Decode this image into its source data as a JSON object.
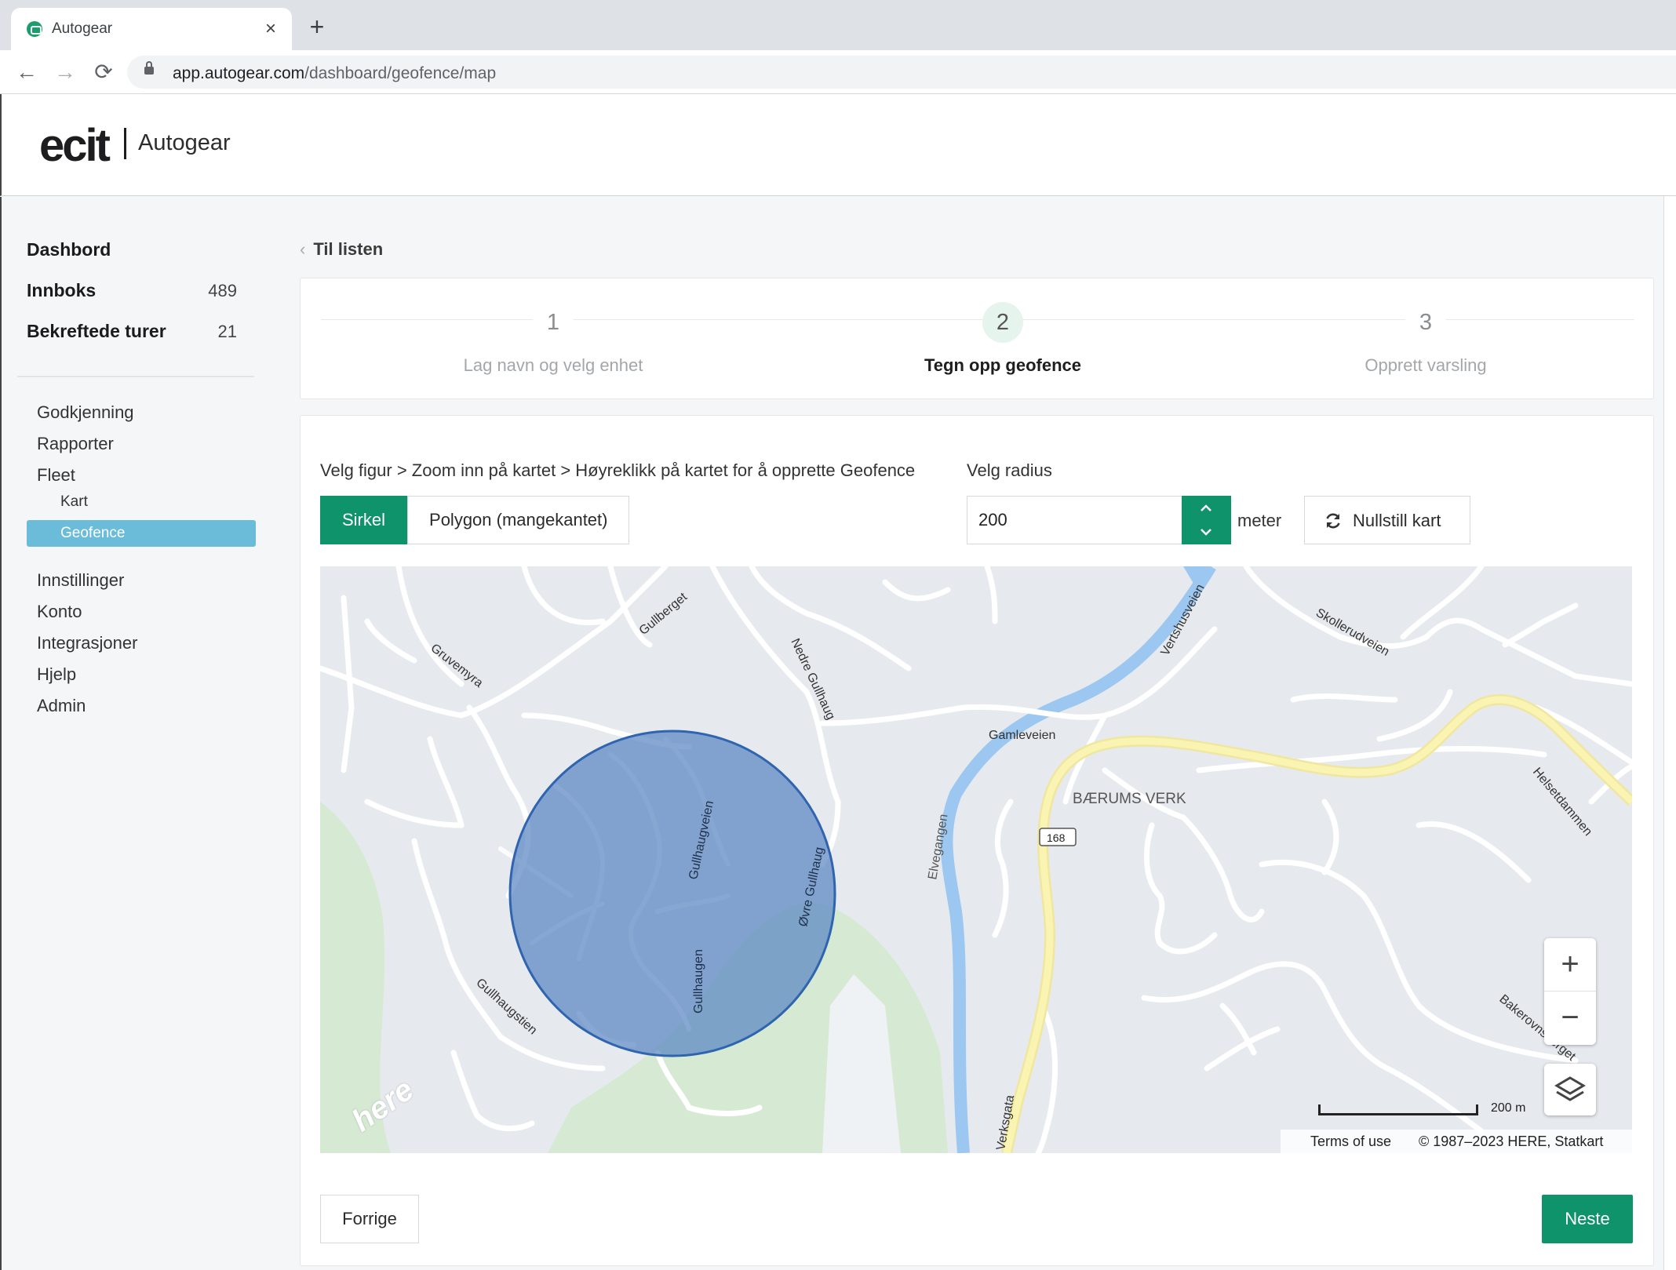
{
  "browser": {
    "tab_title": "Autogear",
    "url_host": "app.autogear.com",
    "url_path": "/dashboard/geofence/map"
  },
  "header": {
    "logo": "ecit",
    "brand": "Autogear"
  },
  "sidebar": {
    "top": [
      {
        "label": "Dashbord",
        "count": null
      },
      {
        "label": "Innboks",
        "count": "489"
      },
      {
        "label": "Bekreftede turer",
        "count": "21"
      }
    ],
    "menu": [
      {
        "label": "Godkjenning"
      },
      {
        "label": "Rapporter"
      },
      {
        "label": "Fleet"
      }
    ],
    "fleet_sub": [
      {
        "label": "Kart",
        "active": false
      },
      {
        "label": "Geofence",
        "active": true
      }
    ],
    "menu2": [
      {
        "label": "Innstillinger"
      },
      {
        "label": "Konto"
      },
      {
        "label": "Integrasjoner"
      },
      {
        "label": "Hjelp"
      },
      {
        "label": "Admin"
      }
    ]
  },
  "main": {
    "back_link": "Til listen",
    "steps": [
      {
        "number": "1",
        "label": "Lag navn og velg enhet",
        "active": false
      },
      {
        "number": "2",
        "label": "Tegn opp geofence",
        "active": true
      },
      {
        "number": "3",
        "label": "Opprett varsling",
        "active": false
      }
    ],
    "instructions": "Velg figur > Zoom inn på kartet > Høyreklikk på kartet for å opprette Geofence",
    "shape_options": [
      {
        "label": "Sirkel",
        "selected": true
      },
      {
        "label": "Polygon (mangekantet)",
        "selected": false
      }
    ],
    "radius_label": "Velg radius",
    "radius_value": "200",
    "radius_unit": "meter",
    "reset_button": "Nullstill kart",
    "prev_button": "Forrige",
    "next_button": "Neste"
  },
  "map": {
    "place_labels": [
      "Gullberget",
      "Gruvemyra",
      "Nedre Gullhaug",
      "Vertshusveien",
      "Skollerudveien",
      "Gamleveien",
      "BÆRUMS VERK",
      "168",
      "Helsetdammen",
      "Elvegangen",
      "Gullhaugveien",
      "Øvre Gullhaug",
      "Gullhaugen",
      "Gullhaugstien",
      "Bakerovnsberget",
      "Verksgata"
    ],
    "scale_label": "200 m",
    "terms": "Terms of use",
    "copyright": "© 1987–2023 HERE, Statkart",
    "logo": "here",
    "geofence_radius_m": 200,
    "colors": {
      "land": "#e6eaee",
      "forest": "#d5e9d3",
      "water": "#9cc7f0",
      "road": "#ffffff",
      "highway": "#f9f1a2",
      "geofence_fill": "#5a86c2",
      "geofence_stroke": "#2f64b0"
    }
  },
  "theme": {
    "primary": "#0f936a",
    "sidebar_active": "#6bbcd8"
  }
}
